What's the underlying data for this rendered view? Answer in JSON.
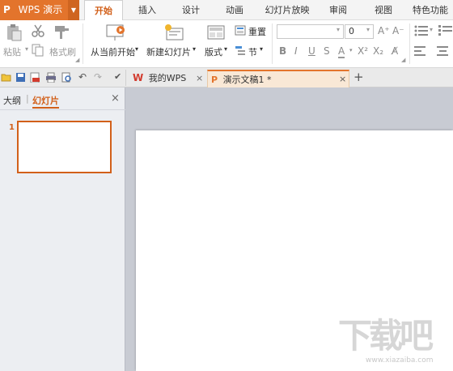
{
  "app": {
    "title": "WPS 演示",
    "logo": "P"
  },
  "tabs": [
    {
      "label": "开始",
      "active": true
    },
    {
      "label": "插入"
    },
    {
      "label": "设计"
    },
    {
      "label": "动画"
    },
    {
      "label": "幻灯片放映"
    },
    {
      "label": "审阅"
    },
    {
      "label": "视图"
    },
    {
      "label": "特色功能"
    }
  ],
  "ribbon": {
    "paste": "粘贴",
    "format_painter": "格式刷",
    "from_current": "从当前开始",
    "new_slide": "新建幻灯片",
    "layout": "版式",
    "reset": "重置",
    "section": "节",
    "font_size": "0"
  },
  "doc_tabs": [
    {
      "label": "我的WPS"
    },
    {
      "label": "演示文稿1 *",
      "active": true
    }
  ],
  "outline_tabs": {
    "outline": "大纲",
    "slides": "幻灯片"
  },
  "slides": [
    {
      "number": "1"
    }
  ],
  "watermark": {
    "text": "下载吧",
    "url": "www.xiazaiba.com"
  },
  "colors": {
    "accent": "#e3742c",
    "active_text": "#d2601a"
  }
}
